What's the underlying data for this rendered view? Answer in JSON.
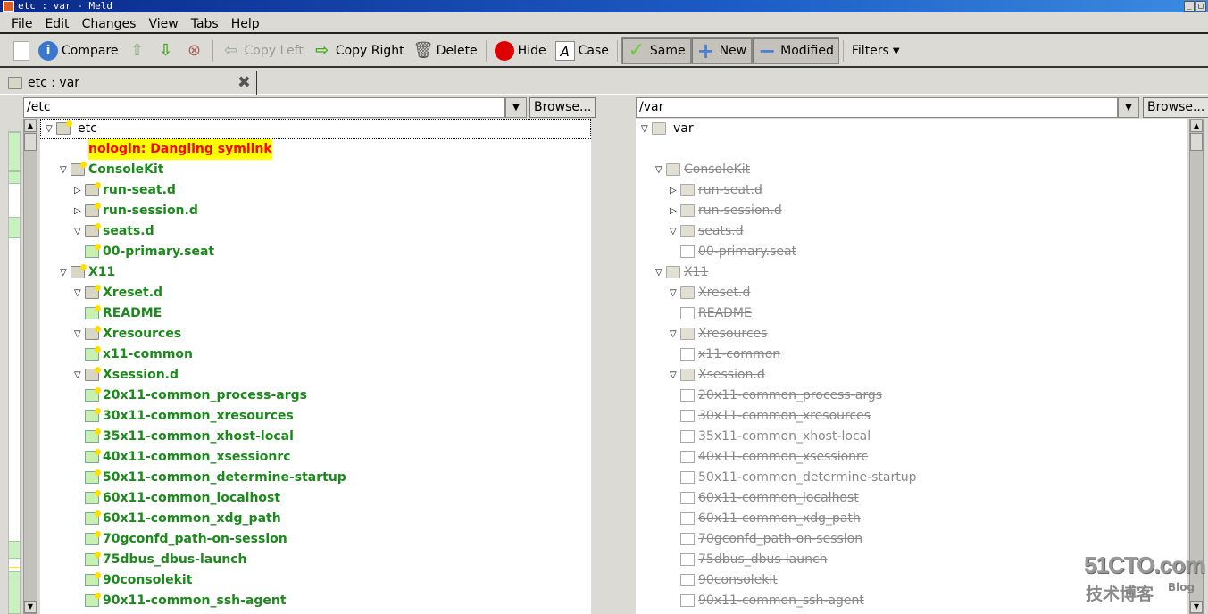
{
  "window": {
    "title": "etc : var - Meld"
  },
  "menu": [
    "File",
    "Edit",
    "Changes",
    "View",
    "Tabs",
    "Help"
  ],
  "toolbar": {
    "compare": "Compare",
    "copy_left": "Copy Left",
    "copy_right": "Copy Right",
    "delete": "Delete",
    "hide": "Hide",
    "case": "Case",
    "same": "Same",
    "new": "New",
    "modified": "Modified",
    "filters": "Filters"
  },
  "tab": {
    "label": "etc : var"
  },
  "left": {
    "path": "/etc",
    "browse": "Browse..."
  },
  "right": {
    "path": "/var",
    "browse": "Browse..."
  },
  "watermark": {
    "site": "51CTO.com",
    "sub": "技术博客",
    "blog": "Blog"
  },
  "colors": {
    "new": "#1a8a1a",
    "missing": "#888888",
    "error": "#ff0000",
    "error_bg": "#ffff00"
  },
  "tree": [
    {
      "level": 0,
      "type": "folder",
      "expanded": true,
      "left": "etc",
      "right": "var",
      "state": "root"
    },
    {
      "level": 1,
      "type": "none",
      "left": "nologin: Dangling symlink",
      "right": "",
      "state": "error"
    },
    {
      "level": 1,
      "type": "folder",
      "expanded": true,
      "left": "ConsoleKit",
      "right": "ConsoleKit",
      "state": "new"
    },
    {
      "level": 2,
      "type": "folder",
      "expanded": false,
      "left": "run-seat.d",
      "right": "run-seat.d",
      "state": "new"
    },
    {
      "level": 2,
      "type": "folder",
      "expanded": false,
      "left": "run-session.d",
      "right": "run-session.d",
      "state": "new"
    },
    {
      "level": 2,
      "type": "folder",
      "expanded": true,
      "left": "seats.d",
      "right": "seats.d",
      "state": "new"
    },
    {
      "level": 3,
      "type": "file",
      "left": "00-primary.seat",
      "right": "00-primary.seat",
      "state": "new"
    },
    {
      "level": 1,
      "type": "folder",
      "expanded": true,
      "left": "X11",
      "right": "X11",
      "state": "new"
    },
    {
      "level": 2,
      "type": "folder",
      "expanded": true,
      "left": "Xreset.d",
      "right": "Xreset.d",
      "state": "new"
    },
    {
      "level": 3,
      "type": "file",
      "left": "README",
      "right": "README",
      "state": "new"
    },
    {
      "level": 2,
      "type": "folder",
      "expanded": true,
      "left": "Xresources",
      "right": "Xresources",
      "state": "new"
    },
    {
      "level": 3,
      "type": "file",
      "left": "x11-common",
      "right": "x11-common",
      "state": "new"
    },
    {
      "level": 2,
      "type": "folder",
      "expanded": true,
      "left": "Xsession.d",
      "right": "Xsession.d",
      "state": "new"
    },
    {
      "level": 3,
      "type": "file",
      "left": "20x11-common_process-args",
      "right": "20x11-common_process-args",
      "state": "new"
    },
    {
      "level": 3,
      "type": "file",
      "left": "30x11-common_xresources",
      "right": "30x11-common_xresources",
      "state": "new"
    },
    {
      "level": 3,
      "type": "file",
      "left": "35x11-common_xhost-local",
      "right": "35x11-common_xhost-local",
      "state": "new"
    },
    {
      "level": 3,
      "type": "file",
      "left": "40x11-common_xsessionrc",
      "right": "40x11-common_xsessionrc",
      "state": "new"
    },
    {
      "level": 3,
      "type": "file",
      "left": "50x11-common_determine-startup",
      "right": "50x11-common_determine-startup",
      "state": "new"
    },
    {
      "level": 3,
      "type": "file",
      "left": "60x11-common_localhost",
      "right": "60x11-common_localhost",
      "state": "new"
    },
    {
      "level": 3,
      "type": "file",
      "left": "60x11-common_xdg_path",
      "right": "60x11-common_xdg_path",
      "state": "new"
    },
    {
      "level": 3,
      "type": "file",
      "left": "70gconfd_path-on-session",
      "right": "70gconfd_path-on-session",
      "state": "new"
    },
    {
      "level": 3,
      "type": "file",
      "left": "75dbus_dbus-launch",
      "right": "75dbus_dbus-launch",
      "state": "new"
    },
    {
      "level": 3,
      "type": "file",
      "left": "90consolekit",
      "right": "90consolekit",
      "state": "new"
    },
    {
      "level": 3,
      "type": "file",
      "left": "90x11-common_ssh-agent",
      "right": "90x11-common_ssh-agent",
      "state": "new"
    }
  ]
}
